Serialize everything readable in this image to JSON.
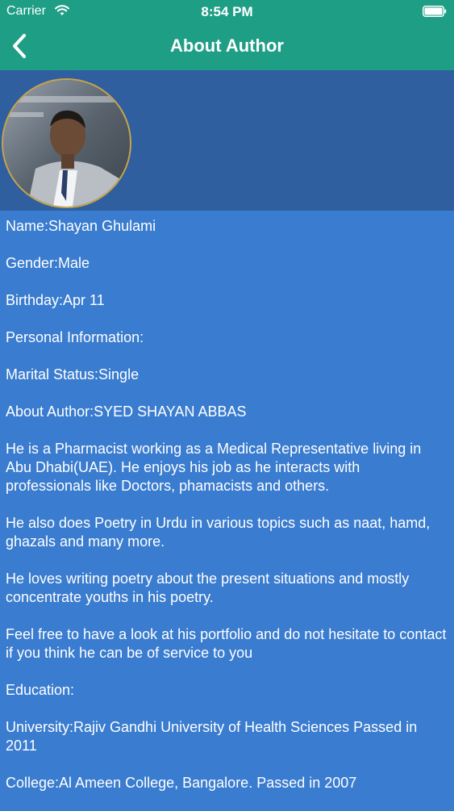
{
  "status_bar": {
    "carrier": "Carrier",
    "time": "8:54 PM"
  },
  "nav": {
    "title": "About Author",
    "back_icon": "chevron-left-icon"
  },
  "colors": {
    "nav_background": "#1f9e86",
    "header_band": "#2f5f9f",
    "content_background": "#3a7ccf",
    "avatar_border": "#c9a44a"
  },
  "profile": {
    "avatar": "author-photo",
    "name_line": "Name:Shayan Ghulami",
    "gender_line": "Gender:Male",
    "birthday_line": "Birthday:Apr 11",
    "personal_heading": "Personal Information:",
    "marital_line": "Marital Status:Single",
    "about_line": "About Author:SYED SHAYAN ABBAS",
    "bio_1": "He is a Pharmacist working as a Medical Representative living in Abu Dhabi(UAE). He enjoys his job as he interacts with professionals like Doctors, phamacists and others.",
    "bio_2": "He also does Poetry in Urdu in various topics such as naat, hamd, ghazals and many more.",
    "bio_3": "He loves writing poetry about the present situations and mostly concentrate youths in his poetry.",
    "bio_4": "Feel free to have a look at his portfolio and do not hesitate to contact if you think he can be of service to you",
    "education_heading": "Education:",
    "university_line": "University:Rajiv Gandhi University of Health Sciences Passed in 2011",
    "college_line": "College:Al Ameen College, Bangalore. Passed in 2007"
  }
}
